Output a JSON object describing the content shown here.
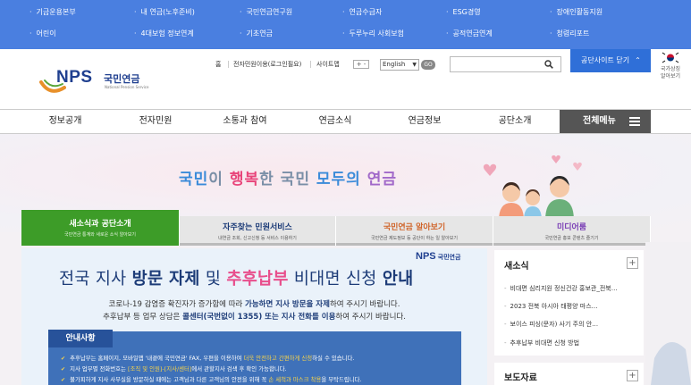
{
  "topbar": {
    "links": [
      "기금운용본부",
      "내 연금(노후준비)",
      "국민연금연구원",
      "연금수급자",
      "ESG경영",
      "장애인활동지원",
      "어린이",
      "4대보험 정보연계",
      "기초연금",
      "두루누리 사회보험",
      "공적연금연계",
      "청렴리포트"
    ]
  },
  "header": {
    "logo_nps": "NPS",
    "logo_ko": "국민연금",
    "logo_en": "National Pension Service",
    "util_links": [
      "홈",
      "전자민원이용(로그인필요)",
      "사이트맵"
    ],
    "font_controls": "+ -",
    "language": "English",
    "go_label": "GO",
    "search_placeholder": "",
    "close_site_label": "공단사이트 닫기",
    "flag_label_1": "국가상징",
    "flag_label_2": "알아보기"
  },
  "gnb": {
    "items": [
      "정보공개",
      "전자민원",
      "소통과 참여",
      "연금소식",
      "연금정보",
      "공단소개"
    ],
    "all_menu": "전체메뉴"
  },
  "hero": {
    "slogan": [
      "국민",
      "이 ",
      "행복",
      "한 국민 ",
      "모두의 ",
      "연금"
    ]
  },
  "tabs": [
    {
      "title": "새소식과 공단소개",
      "sub": "국민연금 통계와 새로운 소식 알아보기"
    },
    {
      "title": "자주찾는 민원서비스",
      "sub": "내연금 조회, 신고신청 등 서비스 이용하기"
    },
    {
      "title": "국민연금 알아보기",
      "sub": "국민연금 제도정보 등 공단이 하는 일 알아보기"
    },
    {
      "title": "미디어룸",
      "sub": "국민연금 홍보 콘텐츠 즐기기"
    }
  ],
  "banner": {
    "logo_nps": "NPS",
    "logo_ko": "국민연금",
    "title_1": "전국 지사 ",
    "title_2": "방문 자제",
    "title_3": " 및 ",
    "title_4": "추후납부",
    "title_5": " 비대면 신청 ",
    "title_6": "안내",
    "desc_1a": "코로나-19 감염증 확진자가 증가함에 따라 ",
    "desc_1b": "가능하면 지사 방문을 자제",
    "desc_1c": "하여 주시기 바랍니다.",
    "desc_2a": "추후납부 등 업무 상담은 ",
    "desc_2b": "콜센터(국번없이 1355) 또는 지사 전화를 이용",
    "desc_2c": "하여 주시기 바랍니다.",
    "notice_title": "안내사항",
    "notice_1a": "추후납부는 홈페이지, 모바일앱 '내곁에 국민연금' FAX, 우편을 이용하여 ",
    "notice_1b": "더욱 안전하고 간편하게 신청",
    "notice_1c": "하실 수 있습니다.",
    "notice_2a": "지사 업무별 전화번호는 ",
    "notice_2b": "[조직 및 인원]-[지사/센터]",
    "notice_2c": "에서 관할지사 검색 후 확인 가능합니다.",
    "notice_3a": "불가피하게 지사 사무실을 방문하실 때에는 고객님과 다른 고객님의 안전을 위해 꼭 ",
    "notice_3b": "손 세척과 마스크 착용",
    "notice_3c": "을 부탁드립니다."
  },
  "news_panel": {
    "title": "새소식",
    "items": [
      "비대면 심리지원 정신건강 홍보관_전북…",
      "2023 전북 아시아 태평양 마스…",
      "보이스 피싱(문자) 사기 주의 안…",
      "추후납부 비대면 신청 방법"
    ]
  },
  "press_panel": {
    "title": "보도자료"
  },
  "colors": {
    "topbar": "#4a7fe0",
    "brand_blue": "#1f3f8f",
    "active_tab": "#3d9c28",
    "close_site": "#2f6fd8"
  }
}
